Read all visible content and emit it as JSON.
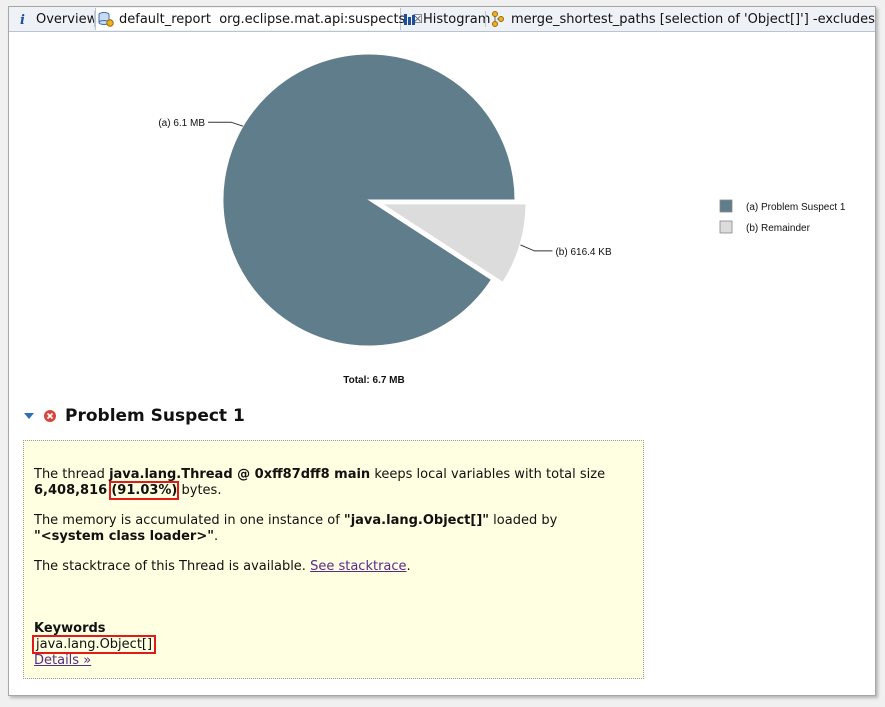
{
  "tabs": [
    {
      "label": "Overview",
      "icon": "info-icon"
    },
    {
      "label": "default_report  org.eclipse.mat.api:suspects",
      "icon": "report-icon",
      "close": "☒"
    },
    {
      "label": "Histogram",
      "icon": "histogram-icon"
    },
    {
      "label": "merge_shortest_paths [selection of 'Object[]'] -excludes java.la",
      "icon": "paths-icon"
    }
  ],
  "colors": {
    "suspect": "#607d8b",
    "remainder": "#dcdcdc",
    "highlight": "#e01b1b",
    "panel": "#ffffe1"
  },
  "chart_data": {
    "type": "pie",
    "title": "",
    "total_label": "Total: 6.7 MB",
    "slices": [
      {
        "label": "(a)  6.1 MB",
        "legend": "(a)  Problem Suspect 1",
        "value": 6.1,
        "color": "#607d8b"
      },
      {
        "label": "(b)  616.4 KB",
        "legend": "(b)  Remainder",
        "value": 0.6164,
        "color": "#dcdcdc"
      }
    ],
    "legend_position": "right"
  },
  "suspect": {
    "title": "Problem Suspect 1",
    "line1_pre": "The thread ",
    "thread": "java.lang.Thread @ 0xff87dff8 main",
    "line1_post": " keeps local variables with total size",
    "size": "6,408,816",
    "percent": "(91.03%)",
    "bytes": " bytes.",
    "mem_pre": "The memory is accumulated in one instance of ",
    "mem_class": "\"java.lang.Object[]\"",
    "mem_post": " loaded by",
    "loader": "\"<system class loader>\"",
    "loader_post": ".",
    "stack_pre": "The stacktrace of this Thread is available. ",
    "stack_link": "See stacktrace",
    "stack_post": ".",
    "keywords_label": "Keywords",
    "keyword": "java.lang.Object[]",
    "details_link": "Details »"
  }
}
